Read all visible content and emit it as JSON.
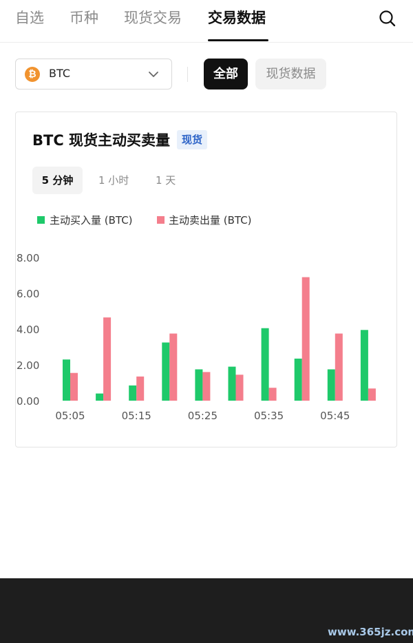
{
  "nav": {
    "tabs": [
      {
        "label": "自选"
      },
      {
        "label": "币种"
      },
      {
        "label": "现货交易"
      },
      {
        "label": "交易数据"
      }
    ],
    "active_index": 3,
    "search_icon": "search-icon"
  },
  "filters": {
    "coin": {
      "symbol": "BTC",
      "icon": "bitcoin-icon",
      "glyph": "₿"
    },
    "pills": [
      {
        "label": "全部",
        "selected": true
      },
      {
        "label": "现货数据",
        "selected": false
      }
    ]
  },
  "card": {
    "title": "BTC 现货主动买卖量",
    "badge": "现货",
    "intervals": [
      {
        "label": "5 分钟",
        "selected": true
      },
      {
        "label": "1 小时",
        "selected": false
      },
      {
        "label": "1 天",
        "selected": false
      }
    ]
  },
  "colors": {
    "buy": "#1ec96a",
    "sell": "#f47e8c",
    "accent": "#111111",
    "badge_bg": "#e8f0fb",
    "badge_text": "#2c63c7",
    "bitcoin": "#f1932f"
  },
  "chart_data": {
    "type": "bar",
    "title": "BTC 现货主动买卖量",
    "x": [
      "05:05",
      "05:10",
      "05:15",
      "05:20",
      "05:25",
      "05:30",
      "05:35",
      "05:40",
      "05:45",
      "05:50"
    ],
    "x_tick_labels": [
      "05:05",
      "05:15",
      "05:25",
      "05:35",
      "05:45"
    ],
    "y_tick_labels": [
      "8.00",
      "6.00",
      "4.00",
      "2.00",
      "0.00"
    ],
    "ylim": [
      0,
      8
    ],
    "grid": false,
    "legend_position": "top-left",
    "series": [
      {
        "name": "主动买入量 (BTC)",
        "color": "#1ec96a",
        "values": [
          2.3,
          0.4,
          0.85,
          3.25,
          1.75,
          1.9,
          4.05,
          2.35,
          1.75,
          3.95
        ]
      },
      {
        "name": "主动卖出量 (BTC)",
        "color": "#f47e8c",
        "values": [
          1.55,
          4.65,
          1.35,
          3.75,
          1.6,
          1.45,
          0.72,
          6.9,
          3.75,
          0.68
        ]
      }
    ]
  },
  "watermark": "www.365jz.com"
}
